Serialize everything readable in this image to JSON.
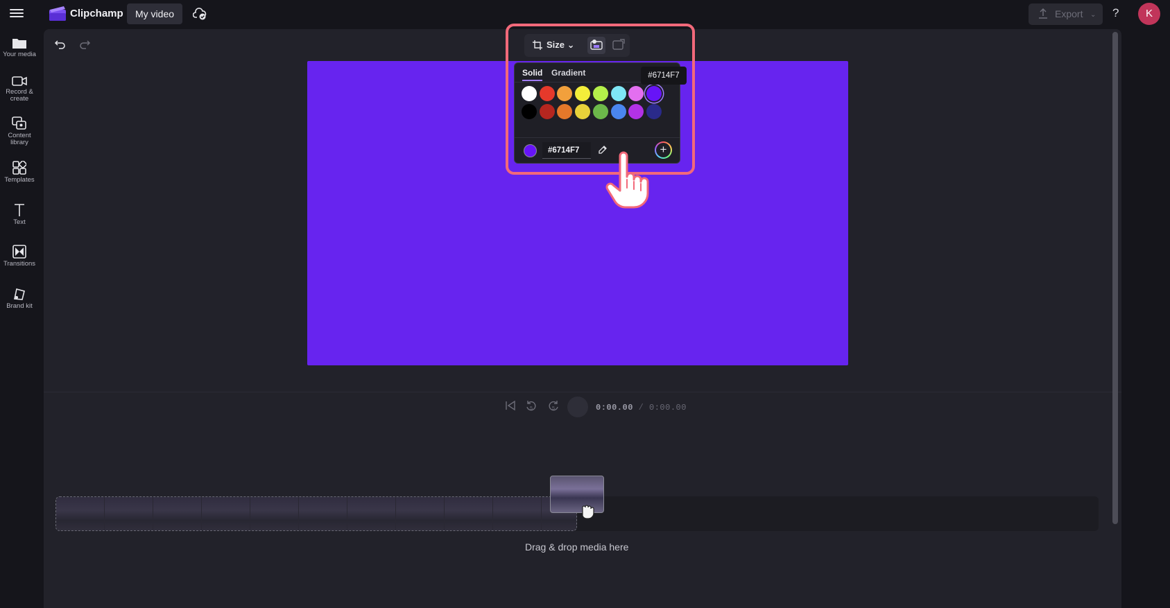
{
  "topbar": {
    "app_name": "Clipchamp",
    "project_tab": "My video",
    "export_label": "Export",
    "help_label": "?",
    "avatar_initial": "K"
  },
  "sidebar": {
    "items": [
      {
        "label": "Your media",
        "icon": "folder-icon"
      },
      {
        "label": "Record &\ncreate",
        "icon": "camera-icon"
      },
      {
        "label": "Content\nlibrary",
        "icon": "content-library-icon"
      },
      {
        "label": "Templates",
        "icon": "templates-icon"
      },
      {
        "label": "Text",
        "icon": "text-icon"
      },
      {
        "label": "Transitions",
        "icon": "transitions-icon"
      },
      {
        "label": "Brand kit",
        "icon": "brand-kit-icon"
      }
    ]
  },
  "preview": {
    "background_color": "#6724EF"
  },
  "toolbar": {
    "size_label": "Size"
  },
  "color_picker": {
    "tabs": [
      "Solid",
      "Gradient"
    ],
    "active_tab": "Solid",
    "tooltip": "#6714F7",
    "hex_value": "#6714F7",
    "swatches_row1": [
      "#ffffff",
      "#e5392b",
      "#f2a03c",
      "#f3ee3a",
      "#b4f04a",
      "#7fe6f5",
      "#e36ff0",
      "#6714f7"
    ],
    "swatches_row2": [
      "#000000",
      "#b5261f",
      "#e4782a",
      "#e8d23a",
      "#6cb84a",
      "#4a86f0",
      "#b232e6",
      "#2a2a8a"
    ],
    "selected_index": 7
  },
  "playback": {
    "current_time": "0:00.00",
    "separator": "/",
    "total_time": "0:00.00"
  },
  "timeline": {
    "drop_label": "Drag & drop media here"
  }
}
